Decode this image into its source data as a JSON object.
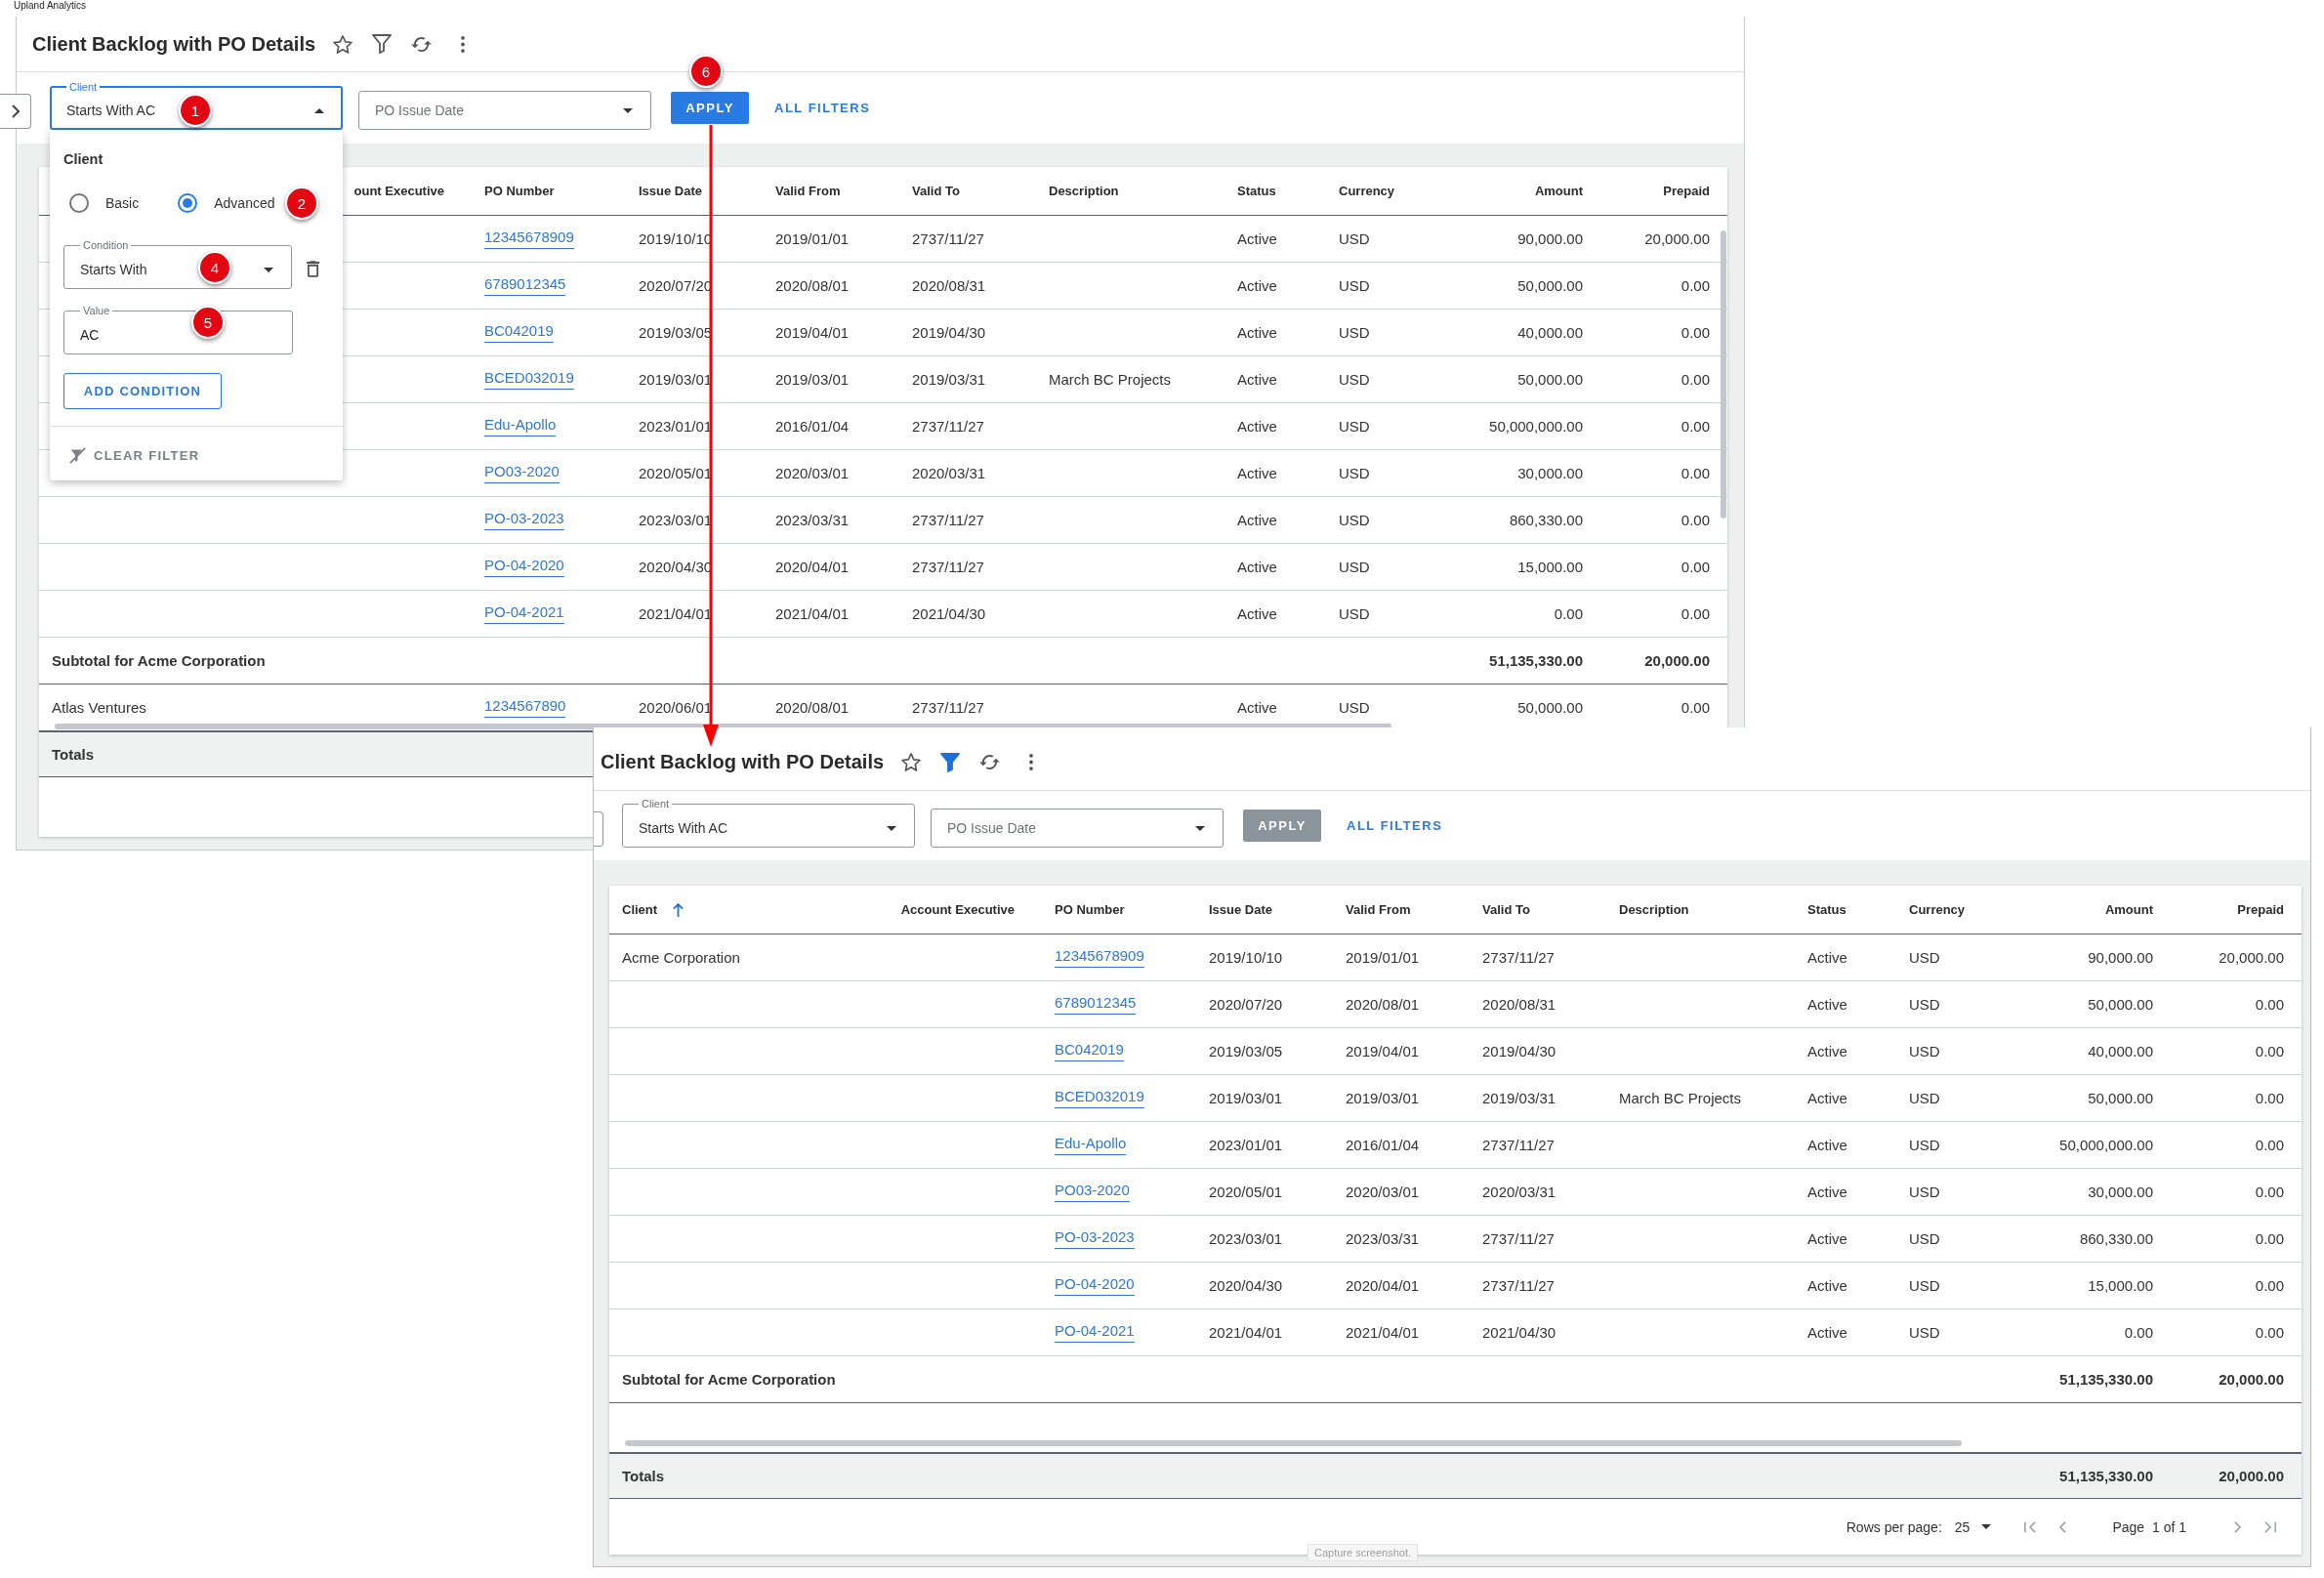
{
  "app_label": "Upland Analytics",
  "views": [
    {
      "title": "Client Backlog with PO Details",
      "filter_applied": false,
      "filters": [
        {
          "kind": "select",
          "label": "Client",
          "value": "Starts With AC",
          "expanded": true,
          "panel": {
            "heading": "Client",
            "modes": [
              {
                "label": "Basic",
                "selected": false
              },
              {
                "label": "Advanced",
                "selected": true
              }
            ],
            "conditions": [
              {
                "condition": {
                  "kind": "select",
                  "label": "Condition",
                  "value": "Starts With",
                  "expanded": false
                },
                "value": {
                  "kind": "input",
                  "label": "Value",
                  "value": "AC"
                }
              }
            ],
            "add_condition": "ADD CONDITION",
            "clear_filter": "CLEAR FILTER"
          }
        },
        {
          "kind": "select",
          "placeholder": "PO Issue Date",
          "expanded": false
        }
      ],
      "apply": {
        "label": "APPLY",
        "disabled": false
      },
      "all_filters": "ALL FILTERS",
      "table": {
        "columns": [
          {
            "label": "ount Executive"
          },
          {
            "label": "PO Number"
          },
          {
            "label": "Issue Date"
          },
          {
            "label": "Valid From"
          },
          {
            "label": "Valid To"
          },
          {
            "label": "Description"
          },
          {
            "label": "Status"
          },
          {
            "label": "Currency"
          },
          {
            "label": "Amount"
          },
          {
            "label": "Prepaid"
          }
        ],
        "rows": [
          {
            "kind": "row",
            "po_number": "12345678909",
            "issue_date": "2019/10/10",
            "valid_from": "2019/01/01",
            "valid_to": "2737/11/27",
            "status": "Active",
            "currency": "USD",
            "amount": "90,000.00",
            "prepaid": "20,000.00"
          },
          {
            "kind": "row",
            "po_number": "6789012345",
            "issue_date": "2020/07/20",
            "valid_from": "2020/08/01",
            "valid_to": "2020/08/31",
            "status": "Active",
            "currency": "USD",
            "amount": "50,000.00",
            "prepaid": "0.00"
          },
          {
            "kind": "row",
            "po_number": "BC042019",
            "issue_date": "2019/03/05",
            "valid_from": "2019/04/01",
            "valid_to": "2019/04/30",
            "status": "Active",
            "currency": "USD",
            "amount": "40,000.00",
            "prepaid": "0.00"
          },
          {
            "kind": "row",
            "po_number": "BCED032019",
            "issue_date": "2019/03/01",
            "valid_from": "2019/03/01",
            "valid_to": "2019/03/31",
            "description": "March BC Projects",
            "status": "Active",
            "currency": "USD",
            "amount": "50,000.00",
            "prepaid": "0.00"
          },
          {
            "kind": "row",
            "po_number": "Edu-Apollo",
            "issue_date": "2023/01/01",
            "valid_from": "2016/01/04",
            "valid_to": "2737/11/27",
            "status": "Active",
            "currency": "USD",
            "amount": "50,000,000.00",
            "prepaid": "0.00"
          },
          {
            "kind": "row",
            "po_number": "PO03-2020",
            "issue_date": "2020/05/01",
            "valid_from": "2020/03/01",
            "valid_to": "2020/03/31",
            "status": "Active",
            "currency": "USD",
            "amount": "30,000.00",
            "prepaid": "0.00"
          },
          {
            "kind": "row",
            "po_number": "PO-03-2023",
            "issue_date": "2023/03/01",
            "valid_from": "2023/03/31",
            "valid_to": "2737/11/27",
            "status": "Active",
            "currency": "USD",
            "amount": "860,330.00",
            "prepaid": "0.00"
          },
          {
            "kind": "row",
            "po_number": "PO-04-2020",
            "issue_date": "2020/04/30",
            "valid_from": "2020/04/01",
            "valid_to": "2737/11/27",
            "status": "Active",
            "currency": "USD",
            "amount": "15,000.00",
            "prepaid": "0.00"
          },
          {
            "kind": "row",
            "po_number": "PO-04-2021",
            "issue_date": "2021/04/01",
            "valid_from": "2021/04/01",
            "valid_to": "2021/04/30",
            "status": "Active",
            "currency": "USD",
            "amount": "0.00",
            "prepaid": "0.00"
          },
          {
            "kind": "subtotal",
            "label": "Subtotal for Acme Corporation",
            "amount": "51,135,330.00",
            "prepaid": "20,000.00"
          },
          {
            "kind": "row",
            "client": "Atlas Ventures",
            "po_number": "1234567890",
            "issue_date": "2020/06/01",
            "valid_from": "2020/08/01",
            "valid_to": "2737/11/27",
            "status": "Active",
            "currency": "USD",
            "amount": "50,000.00",
            "prepaid": "0.00"
          }
        ],
        "totals": {
          "label": "Totals"
        }
      }
    },
    {
      "title": "Client Backlog with PO Details",
      "filter_applied": true,
      "filters": [
        {
          "kind": "select",
          "label": "Client",
          "value": "Starts With AC",
          "expanded": false
        },
        {
          "kind": "select",
          "placeholder": "PO Issue Date",
          "expanded": false
        }
      ],
      "apply": {
        "label": "APPLY",
        "disabled": true
      },
      "all_filters": "ALL FILTERS",
      "table": {
        "columns": [
          {
            "label": "Client",
            "sorted": true
          },
          {
            "label": "Account Executive"
          },
          {
            "label": "PO Number"
          },
          {
            "label": "Issue Date"
          },
          {
            "label": "Valid From"
          },
          {
            "label": "Valid To"
          },
          {
            "label": "Description"
          },
          {
            "label": "Status"
          },
          {
            "label": "Currency"
          },
          {
            "label": "Amount"
          },
          {
            "label": "Prepaid"
          }
        ],
        "rows": [
          {
            "kind": "row",
            "client": "Acme Corporation",
            "po_number": "12345678909",
            "issue_date": "2019/10/10",
            "valid_from": "2019/01/01",
            "valid_to": "2737/11/27",
            "status": "Active",
            "currency": "USD",
            "amount": "90,000.00",
            "prepaid": "20,000.00"
          },
          {
            "kind": "row",
            "po_number": "6789012345",
            "issue_date": "2020/07/20",
            "valid_from": "2020/08/01",
            "valid_to": "2020/08/31",
            "status": "Active",
            "currency": "USD",
            "amount": "50,000.00",
            "prepaid": "0.00"
          },
          {
            "kind": "row",
            "po_number": "BC042019",
            "issue_date": "2019/03/05",
            "valid_from": "2019/04/01",
            "valid_to": "2019/04/30",
            "status": "Active",
            "currency": "USD",
            "amount": "40,000.00",
            "prepaid": "0.00"
          },
          {
            "kind": "row",
            "po_number": "BCED032019",
            "issue_date": "2019/03/01",
            "valid_from": "2019/03/01",
            "valid_to": "2019/03/31",
            "description": "March BC Projects",
            "status": "Active",
            "currency": "USD",
            "amount": "50,000.00",
            "prepaid": "0.00"
          },
          {
            "kind": "row",
            "po_number": "Edu-Apollo",
            "issue_date": "2023/01/01",
            "valid_from": "2016/01/04",
            "valid_to": "2737/11/27",
            "status": "Active",
            "currency": "USD",
            "amount": "50,000,000.00",
            "prepaid": "0.00"
          },
          {
            "kind": "row",
            "po_number": "PO03-2020",
            "issue_date": "2020/05/01",
            "valid_from": "2020/03/01",
            "valid_to": "2020/03/31",
            "status": "Active",
            "currency": "USD",
            "amount": "30,000.00",
            "prepaid": "0.00"
          },
          {
            "kind": "row",
            "po_number": "PO-03-2023",
            "issue_date": "2023/03/01",
            "valid_from": "2023/03/31",
            "valid_to": "2737/11/27",
            "status": "Active",
            "currency": "USD",
            "amount": "860,330.00",
            "prepaid": "0.00"
          },
          {
            "kind": "row",
            "po_number": "PO-04-2020",
            "issue_date": "2020/04/30",
            "valid_from": "2020/04/01",
            "valid_to": "2737/11/27",
            "status": "Active",
            "currency": "USD",
            "amount": "15,000.00",
            "prepaid": "0.00"
          },
          {
            "kind": "row",
            "po_number": "PO-04-2021",
            "issue_date": "2021/04/01",
            "valid_from": "2021/04/01",
            "valid_to": "2021/04/30",
            "status": "Active",
            "currency": "USD",
            "amount": "0.00",
            "prepaid": "0.00"
          },
          {
            "kind": "subtotal",
            "label": "Subtotal for Acme Corporation",
            "amount": "51,135,330.00",
            "prepaid": "20,000.00"
          }
        ],
        "totals": {
          "label": "Totals",
          "amount": "51,135,330.00",
          "prepaid": "20,000.00"
        },
        "pagination": {
          "rows_per_page_label": "Rows per page:",
          "rows_per_page": "25",
          "page_label": "Page",
          "page_info": "1 of 1"
        }
      }
    }
  ],
  "annotations": {
    "markers": [
      "1",
      "2",
      "4",
      "5",
      "6"
    ]
  },
  "tooltip": "Capture screenshot."
}
